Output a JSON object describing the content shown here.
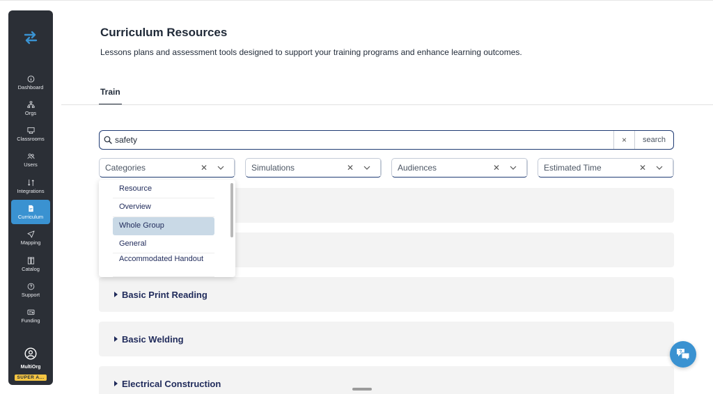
{
  "sidebar": {
    "items": [
      {
        "label": "Dashboard",
        "icon": "info-circle-icon"
      },
      {
        "label": "Orgs",
        "icon": "org-tree-icon"
      },
      {
        "label": "Classrooms",
        "icon": "classroom-icon"
      },
      {
        "label": "Users",
        "icon": "users-icon"
      },
      {
        "label": "Integrations",
        "icon": "integrations-icon"
      },
      {
        "label": "Curriculum",
        "icon": "document-icon",
        "active": true
      },
      {
        "label": "Mapping",
        "icon": "send-icon"
      },
      {
        "label": "Catalog",
        "icon": "catalog-icon"
      },
      {
        "label": "Support",
        "icon": "question-circle-icon"
      },
      {
        "label": "Funding",
        "icon": "funding-icon"
      }
    ],
    "account": {
      "name": "MultiOrg",
      "badge": "SUPER A..."
    }
  },
  "header": {
    "title": "Curriculum Resources",
    "subtitle": "Lessons plans and assessment tools designed to support your training programs and enhance learning outcomes."
  },
  "tabs": [
    {
      "label": "Train",
      "active": true
    }
  ],
  "search": {
    "value": "safety",
    "clear_label": "×",
    "button_label": "search"
  },
  "filters": [
    {
      "label": "Categories"
    },
    {
      "label": "Simulations"
    },
    {
      "label": "Audiences"
    },
    {
      "label": "Estimated Time"
    }
  ],
  "dropdown": {
    "options": [
      "Resource",
      "Overview",
      "Whole Group",
      "General",
      "Accommodated Handout"
    ],
    "selected": "Whole Group"
  },
  "sections": [
    "",
    "",
    "Basic Print Reading",
    "Basic Welding",
    "Electrical Construction"
  ],
  "colors": {
    "sidebar_bg": "#2b2f36",
    "accent": "#3a92d1",
    "primary_text": "#1f2a5a",
    "badge": "#f5c542"
  }
}
